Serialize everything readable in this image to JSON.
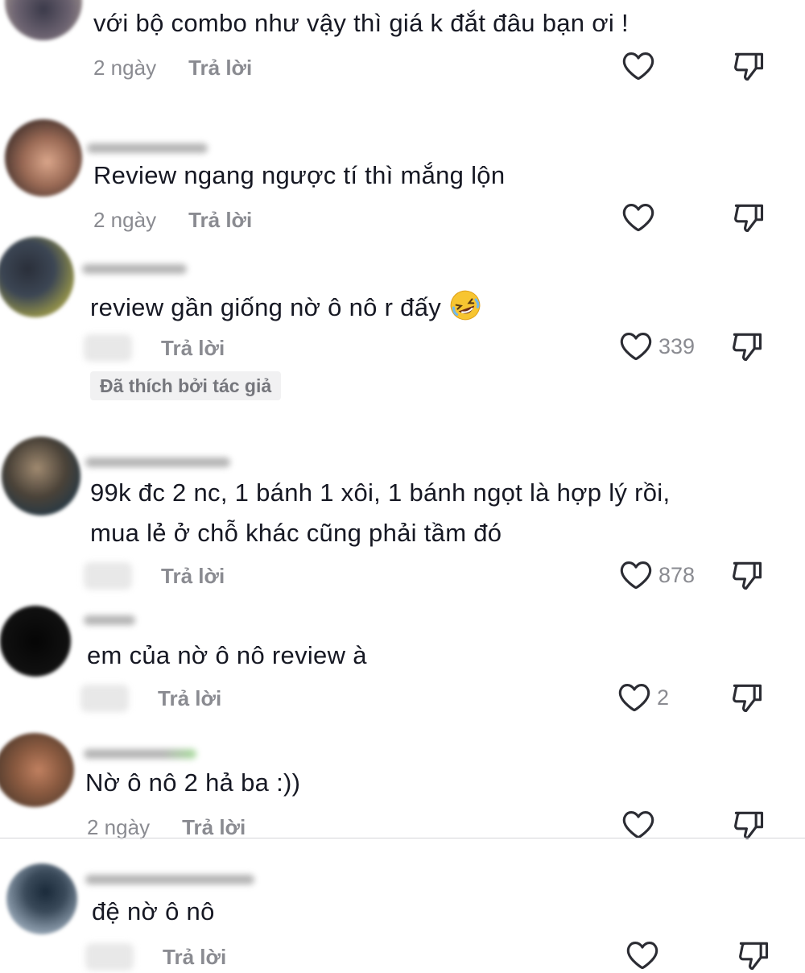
{
  "comments": [
    {
      "text": "với bộ combo như vậy thì giá k đắt đâu bạn ơi !",
      "time": "2 ngày",
      "reply": "Trả lời",
      "likes": ""
    },
    {
      "text": "Review ngang ngược tí thì mắng lộn",
      "time": "2 ngày",
      "reply": "Trả lời",
      "likes": ""
    },
    {
      "text": "review gần giống nờ ô nô r đấy",
      "reply": "Trả lời",
      "likes": "339",
      "badge": "Đã thích bởi tác giả"
    },
    {
      "text_line1": "99k đc 2 nc, 1 bánh 1 xôi, 1 bánh ngọt là hợp lý rồi,",
      "text_line2": "mua lẻ ở chỗ khác cũng phải tầm đó",
      "reply": "Trả lời",
      "likes": "878"
    },
    {
      "text": "em của nờ ô nô review à",
      "reply": "Trả lời",
      "likes": "2"
    },
    {
      "text": "Nờ ô nô 2 hả ba :))",
      "time": "2 ngày",
      "reply": "Trả lời",
      "likes": ""
    },
    {
      "text": "đệ nờ ô nô",
      "reply": "Trả lời",
      "likes": ""
    }
  ],
  "icons": {
    "like": "heart-outline-icon",
    "dislike": "thumbs-down-outline-icon",
    "emoji": "rolling-on-floor-laughing-emoji"
  },
  "colors": {
    "text": "#161823",
    "meta": "#8a8b91",
    "badge_bg": "#f1f1f2"
  }
}
